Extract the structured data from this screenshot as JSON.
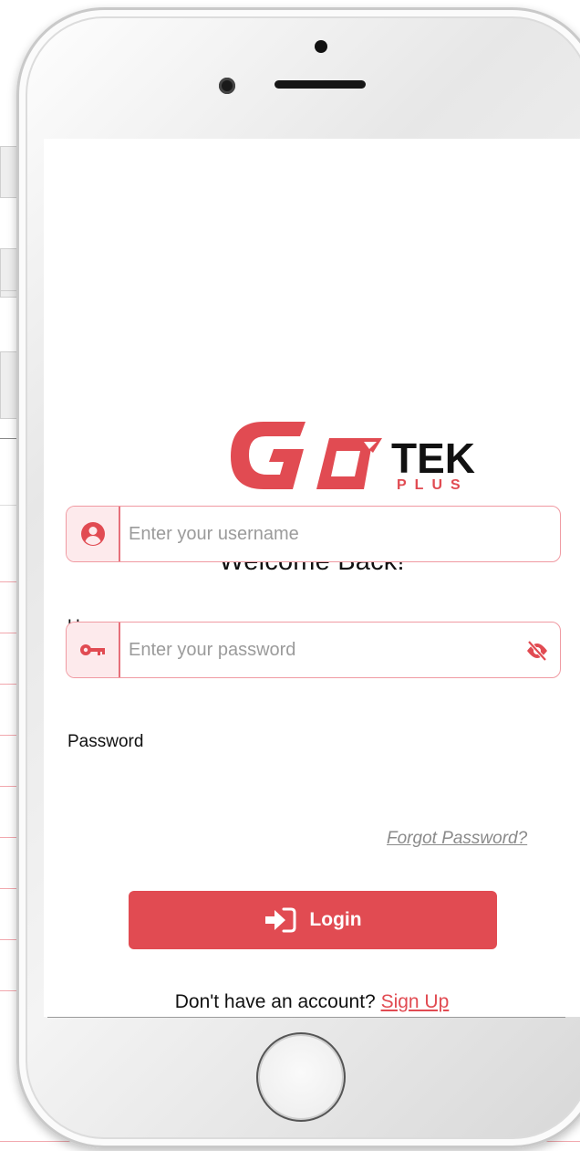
{
  "app": {
    "logo_main": "GO",
    "logo_tek": "TEK",
    "logo_plus": "PLUS"
  },
  "welcome_title": "Welcome Back!",
  "username": {
    "label": "Username",
    "placeholder": "Enter your username",
    "icon": "user-circle-icon"
  },
  "password": {
    "label": "Password",
    "placeholder": "Enter your password",
    "icon": "key-icon",
    "toggle_icon": "eye-slash-icon"
  },
  "forgot_password": "Forgot Password?",
  "login_button": {
    "label": "Login",
    "icon": "sign-in-icon"
  },
  "signup": {
    "prompt": "Don't have an account?",
    "link": "Sign Up"
  },
  "colors": {
    "brand": "#e14b52",
    "field_border": "#f09aa2"
  }
}
